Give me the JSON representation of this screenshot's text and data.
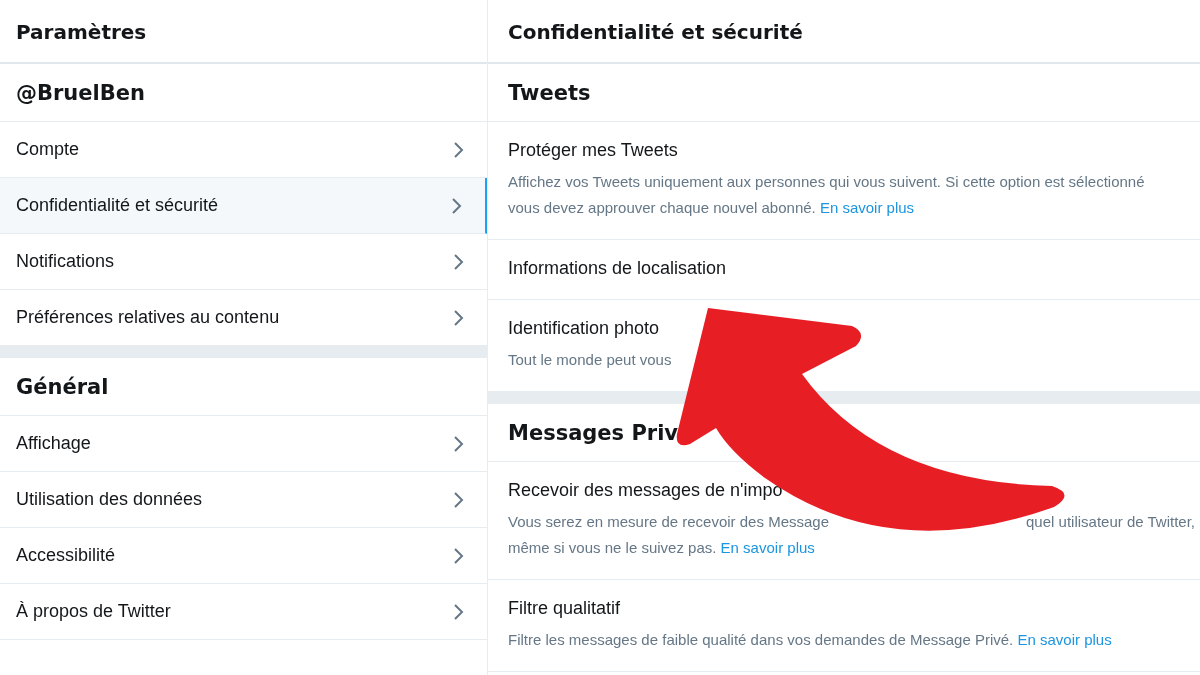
{
  "sidebar": {
    "title": "Paramètres",
    "sections": [
      {
        "heading": "@BruelBen",
        "items": [
          {
            "label": "Compte",
            "selected": false
          },
          {
            "label": "Confidentialité et sécurité",
            "selected": true
          },
          {
            "label": "Notifications",
            "selected": false
          },
          {
            "label": "Préférences relatives au contenu",
            "selected": false
          }
        ]
      },
      {
        "heading": "Général",
        "items": [
          {
            "label": "Affichage",
            "selected": false
          },
          {
            "label": "Utilisation des données",
            "selected": false
          },
          {
            "label": "Accessibilité",
            "selected": false
          },
          {
            "label": "À propos de Twitter",
            "selected": false
          }
        ]
      }
    ]
  },
  "content": {
    "title": "Confidentialité et sécurité",
    "sections": [
      {
        "heading": "Tweets",
        "settings": [
          {
            "label": "Protéger mes Tweets",
            "description": "Affichez vos Tweets uniquement aux personnes qui vous suivent. Si cette option est sélectionné vous devez approuver chaque nouvel abonné.",
            "link": "En savoir plus"
          },
          {
            "label": "Informations de localisation"
          },
          {
            "label": "Identification photo",
            "description": "Tout le monde peut vous"
          }
        ]
      },
      {
        "heading": "Messages Priv",
        "settings": [
          {
            "label": "Recevoir des messages de n'impo",
            "fragments": [
              "Vous serez en mesure de recevoir des Message",
              "quel utilisateur de Twitter,"
            ],
            "description": "même si vous ne le suivez pas.",
            "link": "En savoir plus"
          },
          {
            "label": "Filtre qualitatif",
            "description": "Filtre les messages de faible qualité dans vos demandes de Message Privé.",
            "link": "En savoir plus"
          }
        ]
      }
    ]
  }
}
